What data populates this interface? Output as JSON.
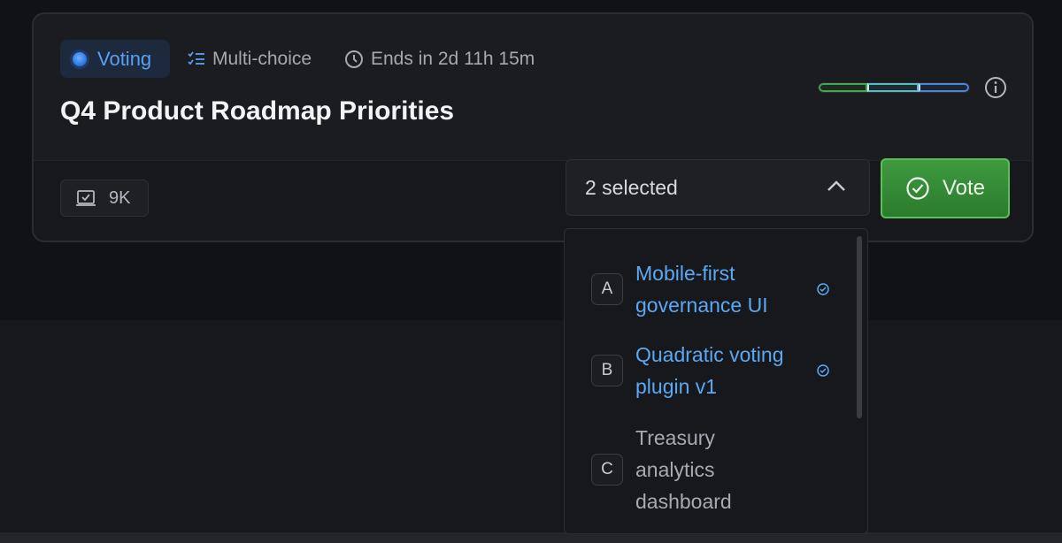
{
  "proposal": {
    "status_label": "Voting",
    "type_label": "Multi-choice",
    "ends_label": "Ends in 2d 11h 15m",
    "title": "Q4 Product Roadmap Priorities",
    "vote_count": "9K",
    "progress_segments": [
      {
        "color": "#46a358"
      },
      {
        "color": "#5bb9c4"
      },
      {
        "color": "#4f86d1"
      }
    ]
  },
  "select": {
    "value": "2 selected",
    "expanded": true
  },
  "vote_button": {
    "label": "Vote"
  },
  "options": [
    {
      "letter": "A",
      "label": "Mobile-first governance UI",
      "selected": true
    },
    {
      "letter": "B",
      "label": "Quadratic voting plugin v1",
      "selected": true
    },
    {
      "letter": "C",
      "label": "Treasury analytics dashboard",
      "selected": false
    }
  ],
  "colors": {
    "accent_blue": "#5ba8f5",
    "vote_green": "#3f9a3f",
    "background": "#111215"
  }
}
